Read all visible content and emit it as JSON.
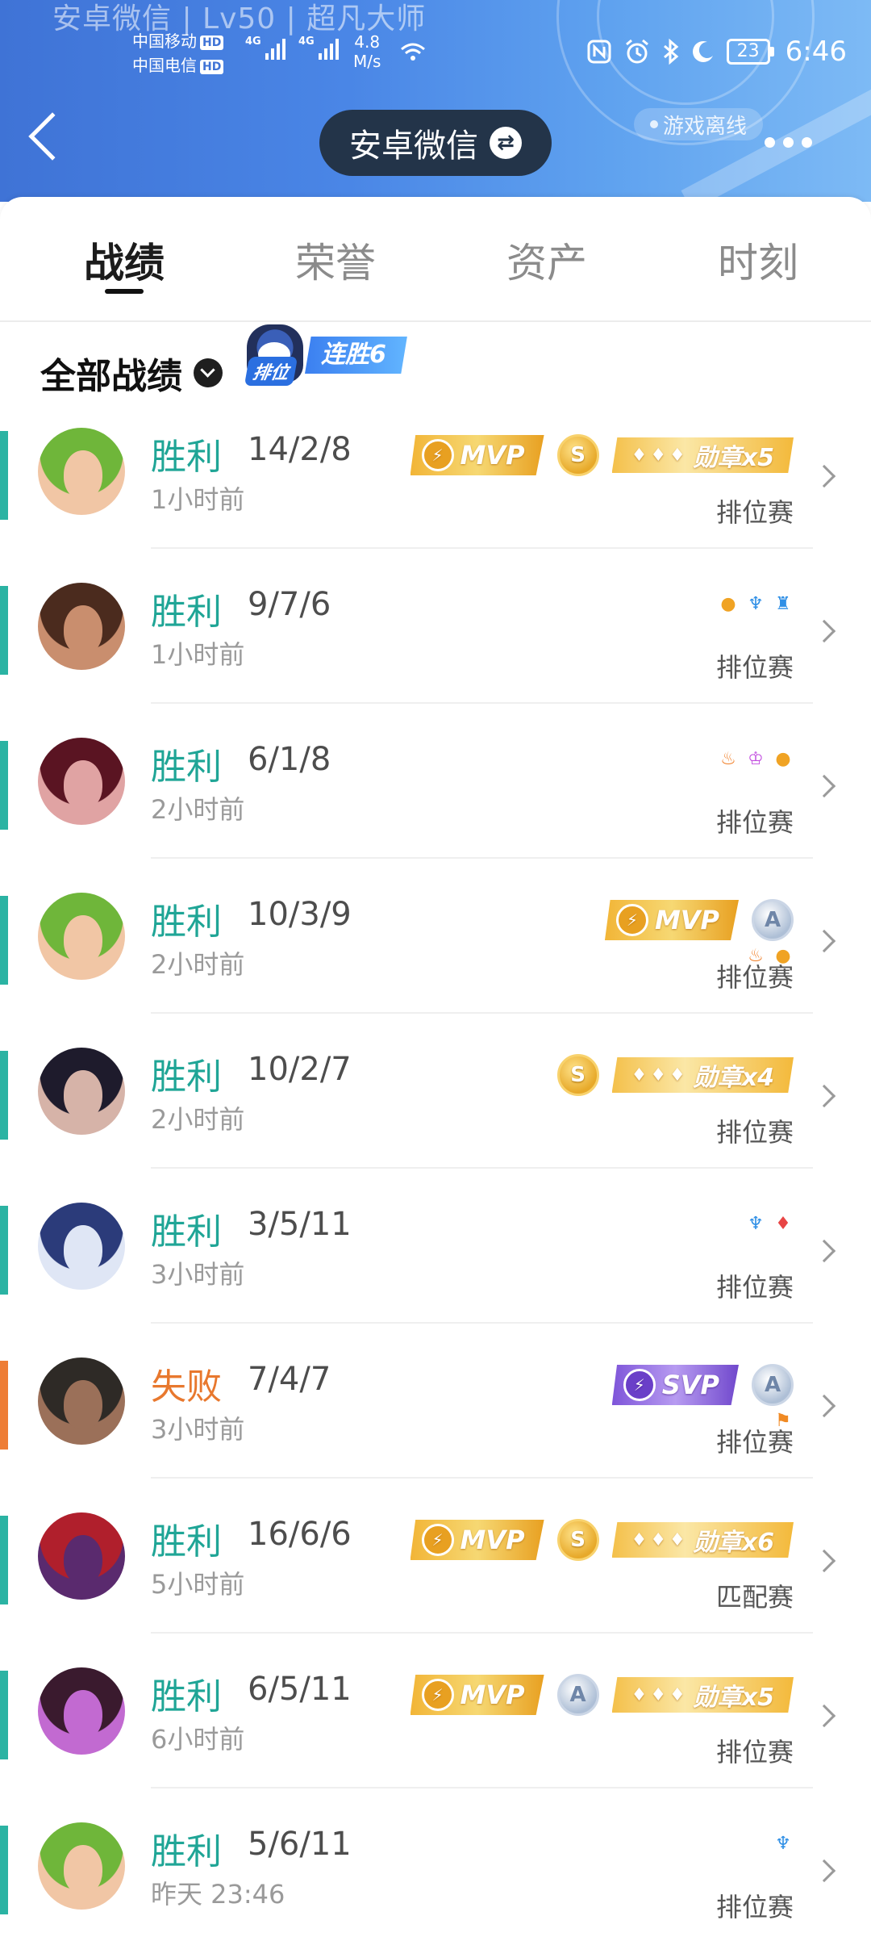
{
  "status_bar": {
    "carrier_1": "中国移动",
    "carrier_2": "中国电信",
    "hd_label": "HD",
    "network_1": "4G",
    "network_2": "4G",
    "speed_value": "4.8",
    "speed_unit": "M/s",
    "battery": "23",
    "time": "6:46"
  },
  "header": {
    "profile_background_text": "安卓微信 | Lv50 | 超凡大师",
    "title": "安卓微信",
    "game_status": "游戏离线",
    "colors": {
      "gradient_start": "#3f73d6",
      "gradient_end": "#7dbaf5",
      "pill": "#233449"
    }
  },
  "tabs": [
    {
      "label": "战绩",
      "active": true
    },
    {
      "label": "荣誉",
      "active": false
    },
    {
      "label": "资产",
      "active": false
    },
    {
      "label": "时刻",
      "active": false
    }
  ],
  "filter": {
    "label": "全部战绩",
    "streak_rank_label": "排位",
    "streak_text": "连胜6"
  },
  "colors": {
    "win": "#1fa596",
    "loss": "#e8782e",
    "win_bar": "#2bb3a3",
    "loss_bar": "#ee7d35"
  },
  "matches": [
    {
      "result": "胜利",
      "kda": "14/2/8",
      "time_ago": "1小时前",
      "mode": "排位赛",
      "outcome": "win",
      "mvp": {
        "label": "MVP",
        "style": "gold"
      },
      "medal": "S",
      "honor": {
        "label": "勋章x5"
      },
      "icons": []
    },
    {
      "result": "胜利",
      "kda": "9/7/6",
      "time_ago": "1小时前",
      "mode": "排位赛",
      "outcome": "win",
      "icons": [
        "coin-stack-icon",
        "wings-icon",
        "tower-icon"
      ]
    },
    {
      "result": "胜利",
      "kda": "6/1/8",
      "time_ago": "2小时前",
      "mode": "排位赛",
      "outcome": "win",
      "icons": [
        "fire-icon",
        "demon-icon",
        "coin-stack-icon"
      ]
    },
    {
      "result": "胜利",
      "kda": "10/3/9",
      "time_ago": "2小时前",
      "mode": "排位赛",
      "outcome": "win",
      "mvp": {
        "label": "MVP",
        "style": "gold"
      },
      "medal": "A",
      "icons": [
        "fire-icon",
        "coin-stack-icon"
      ]
    },
    {
      "result": "胜利",
      "kda": "10/2/7",
      "time_ago": "2小时前",
      "mode": "排位赛",
      "outcome": "win",
      "medal": "S",
      "honor": {
        "label": "勋章x4"
      },
      "icons": []
    },
    {
      "result": "胜利",
      "kda": "3/5/11",
      "time_ago": "3小时前",
      "mode": "排位赛",
      "outcome": "win",
      "icons": [
        "wings-icon",
        "blood-drop-icon"
      ]
    },
    {
      "result": "失败",
      "kda": "7/4/7",
      "time_ago": "3小时前",
      "mode": "排位赛",
      "outcome": "loss",
      "mvp": {
        "label": "SVP",
        "style": "purple"
      },
      "medal": "A",
      "icons": [
        "flag-icon"
      ]
    },
    {
      "result": "胜利",
      "kda": "16/6/6",
      "time_ago": "5小时前",
      "mode": "匹配赛",
      "outcome": "win",
      "mvp": {
        "label": "MVP",
        "style": "gold"
      },
      "medal": "S",
      "honor": {
        "label": "勋章x6"
      },
      "icons": []
    },
    {
      "result": "胜利",
      "kda": "6/5/11",
      "time_ago": "6小时前",
      "mode": "排位赛",
      "outcome": "win",
      "mvp": {
        "label": "MVP",
        "style": "gold"
      },
      "medal": "A",
      "honor": {
        "label": "勋章x5"
      },
      "icons": []
    },
    {
      "result": "胜利",
      "kda": "5/6/11",
      "time_ago": "昨天 23:46",
      "mode": "排位赛",
      "outcome": "win",
      "icons": [
        "wings-icon"
      ]
    }
  ]
}
